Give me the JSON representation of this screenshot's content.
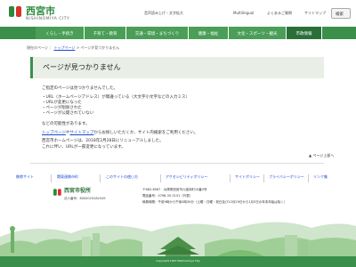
{
  "header": {
    "title": "西宮市",
    "subtitle": "NISHINOMIYA CITY",
    "links": [
      "音声読み上げ・文字拡大",
      "Multilingual",
      "よくあるご質問",
      "サイトマップ"
    ],
    "search_label": "検索"
  },
  "nav": {
    "items": [
      "くらし・手続き",
      "子育て・教育",
      "交通・環境・まちづくり",
      "健康・福祉",
      "文化・スポーツ・観光",
      "市政情報"
    ]
  },
  "breadcrumb": {
    "current": "現在のページ",
    "home": "トップページ",
    "page": "ページが見つかりません"
  },
  "main": {
    "title": "ページが見つかりません",
    "intro": "ご指定のページは見つかりませんでした。",
    "bullets": [
      "・URL（ホームページアドレス）が間違っている（大文字小文字などの入力ミス）",
      "・URLが変更になった",
      "・ページが削除された",
      "・ページが公開されていない"
    ],
    "reason": "などの可能性があります。",
    "guide_link1": "トップページ",
    "guide_mid": "や",
    "guide_link2": "サイトマップ",
    "guide_tail": "からお探しいただくか、サイト内検索をご利用ください。",
    "renewal1": "西宮市ホームページは、2018年2月28日にリニューアルしました。",
    "renewal2": "これに伴い、URLが一部変更になっています。",
    "pagetop": "ページ上部へ"
  },
  "footer_nav": [
    "携帯サイト",
    "関東連携市町",
    "このサイトの使い方",
    "アクセシビリティポリシー",
    "サイトポリシー",
    "プライバシーポリシー",
    "リンク集"
  ],
  "footer": {
    "name": "西宮市役所",
    "corp_no": "法人番号：8000020282049",
    "address": [
      "〒662-8567　兵庫県西宮市六湛寺町10番3号",
      "電話番号：0798-35-3151（代表）",
      "執務時間：午前9時から午後5時30分（土曜・日曜・祝日及び12月29日から1月3日の年末年始は除く）"
    ],
    "service_link": "▶ 窓口・サービスセンターのご案内について",
    "copyright": "Copyright 1997 Nishinomiya City"
  },
  "colors": {
    "brand_green": "#3a8f4a",
    "logo_red": "#d8322b",
    "link": "#1a4ad0"
  }
}
